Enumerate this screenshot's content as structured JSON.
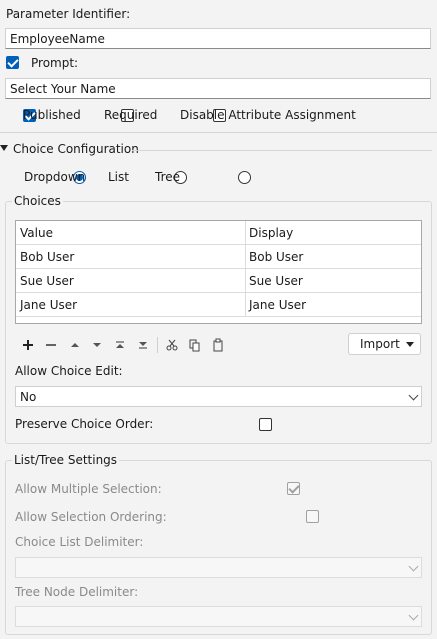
{
  "param_identifier": {
    "label": "Parameter Identifier:",
    "value": "EmployeeName"
  },
  "prompt": {
    "label": "Prompt:",
    "checked": true,
    "value": "Select Your Name"
  },
  "options": {
    "published": "Published",
    "required": "Required",
    "disable_attr": "Disable Attribute Assignment"
  },
  "choice_config": {
    "title": "Choice Configuration",
    "modes": [
      "Dropdown",
      "List",
      "Tree"
    ],
    "selected_mode": "Dropdown"
  },
  "choices": {
    "title": "Choices",
    "columns": [
      "Value",
      "Display"
    ],
    "rows": [
      [
        "Bob User",
        "Bob User"
      ],
      [
        "Sue User",
        "Sue User"
      ],
      [
        "Jane User",
        "Jane User"
      ]
    ],
    "toolbar_icons": [
      "plus-icon",
      "minus-icon",
      "move-up-icon",
      "move-down-icon",
      "move-top-icon",
      "move-bottom-icon",
      "cut-icon",
      "copy-icon",
      "paste-icon"
    ],
    "import_label": "Import"
  },
  "allow_edit": {
    "label": "Allow Choice Edit:",
    "value": "No"
  },
  "preserve_order": {
    "label": "Preserve Choice Order:"
  },
  "list_tree": {
    "title": "List/Tree Settings",
    "allow_multi": "Allow Multiple Selection:",
    "allow_ordering": "Allow Selection Ordering:",
    "list_delim": "Choice List Delimiter:",
    "tree_delim": "Tree Node Delimiter:"
  },
  "colors": {
    "accent": "#005fb8",
    "disabled_text": "#8a8a8a"
  }
}
